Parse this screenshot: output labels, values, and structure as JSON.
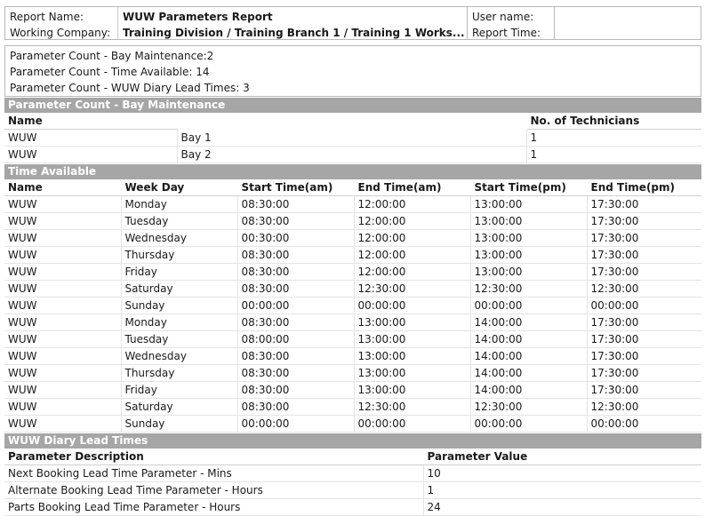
{
  "header": {
    "report_name_label": "Report Name:",
    "report_name_value": "WUW Parameters Report",
    "working_company_label": "Working Company:",
    "working_company_value": "Training Division / Training Branch 1 / Training 1 Works...",
    "user_name_label": "User name:",
    "user_name_value": "",
    "report_time_label": "Report Time:",
    "report_time_value": ""
  },
  "summary": [
    "Parameter Count - Bay Maintenance:2",
    "Parameter Count - Time Available: 14",
    "Parameter Count - WUW Diary Lead Times: 3"
  ],
  "bay_maintenance": {
    "title": "Parameter Count - Bay Maintenance",
    "columns": [
      "Name",
      "",
      "No. of Technicians"
    ],
    "rows": [
      [
        "WUW",
        "Bay 1",
        "1"
      ],
      [
        "WUW",
        "Bay 2",
        "1"
      ]
    ]
  },
  "time_available": {
    "title": "Time Available",
    "columns": [
      "Name",
      "Week Day",
      "Start Time(am)",
      "End Time(am)",
      "Start Time(pm)",
      "End Time(pm)"
    ],
    "rows": [
      [
        "WUW",
        "Monday",
        "08:30:00",
        "12:00:00",
        "13:00:00",
        "17:30:00"
      ],
      [
        "WUW",
        "Tuesday",
        "08:30:00",
        "12:00:00",
        "13:00:00",
        "17:30:00"
      ],
      [
        "WUW",
        "Wednesday",
        "00:30:00",
        "12:00:00",
        "13:00:00",
        "17:30:00"
      ],
      [
        "WUW",
        "Thursday",
        "08:30:00",
        "12:00:00",
        "13:00:00",
        "17:30:00"
      ],
      [
        "WUW",
        "Friday",
        "08:30:00",
        "12:00:00",
        "13:00:00",
        "17:30:00"
      ],
      [
        "WUW",
        "Saturday",
        "08:30:00",
        "12:30:00",
        "12:30:00",
        "12:30:00"
      ],
      [
        "WUW",
        "Sunday",
        "00:00:00",
        "00:00:00",
        "00:00:00",
        "00:00:00"
      ],
      [
        "WUW",
        "Monday",
        "08:30:00",
        "13:00:00",
        "14:00:00",
        "17:30:00"
      ],
      [
        "WUW",
        "Tuesday",
        "08:00:00",
        "13:00:00",
        "14:00:00",
        "17:30:00"
      ],
      [
        "WUW",
        "Wednesday",
        "08:30:00",
        "13:00:00",
        "14:00:00",
        "17:30:00"
      ],
      [
        "WUW",
        "Thursday",
        "08:30:00",
        "13:00:00",
        "14:00:00",
        "17:30:00"
      ],
      [
        "WUW",
        "Friday",
        "08:30:00",
        "13:00:00",
        "14:00:00",
        "17:30:00"
      ],
      [
        "WUW",
        "Saturday",
        "08:30:00",
        "12:30:00",
        "12:30:00",
        "12:30:00"
      ],
      [
        "WUW",
        "Sunday",
        "00:00:00",
        "00:00:00",
        "00:00:00",
        "00:00:00"
      ]
    ]
  },
  "diary_lead_times": {
    "title": "WUW Diary Lead Times",
    "columns": [
      "Parameter Description",
      "Parameter Value"
    ],
    "rows": [
      [
        "Next Booking Lead Time Parameter - Mins",
        "10"
      ],
      [
        "Alternate Booking Lead Time Parameter - Hours",
        "1"
      ],
      [
        "Parts Booking Lead Time Parameter - Hours",
        "24"
      ]
    ]
  }
}
